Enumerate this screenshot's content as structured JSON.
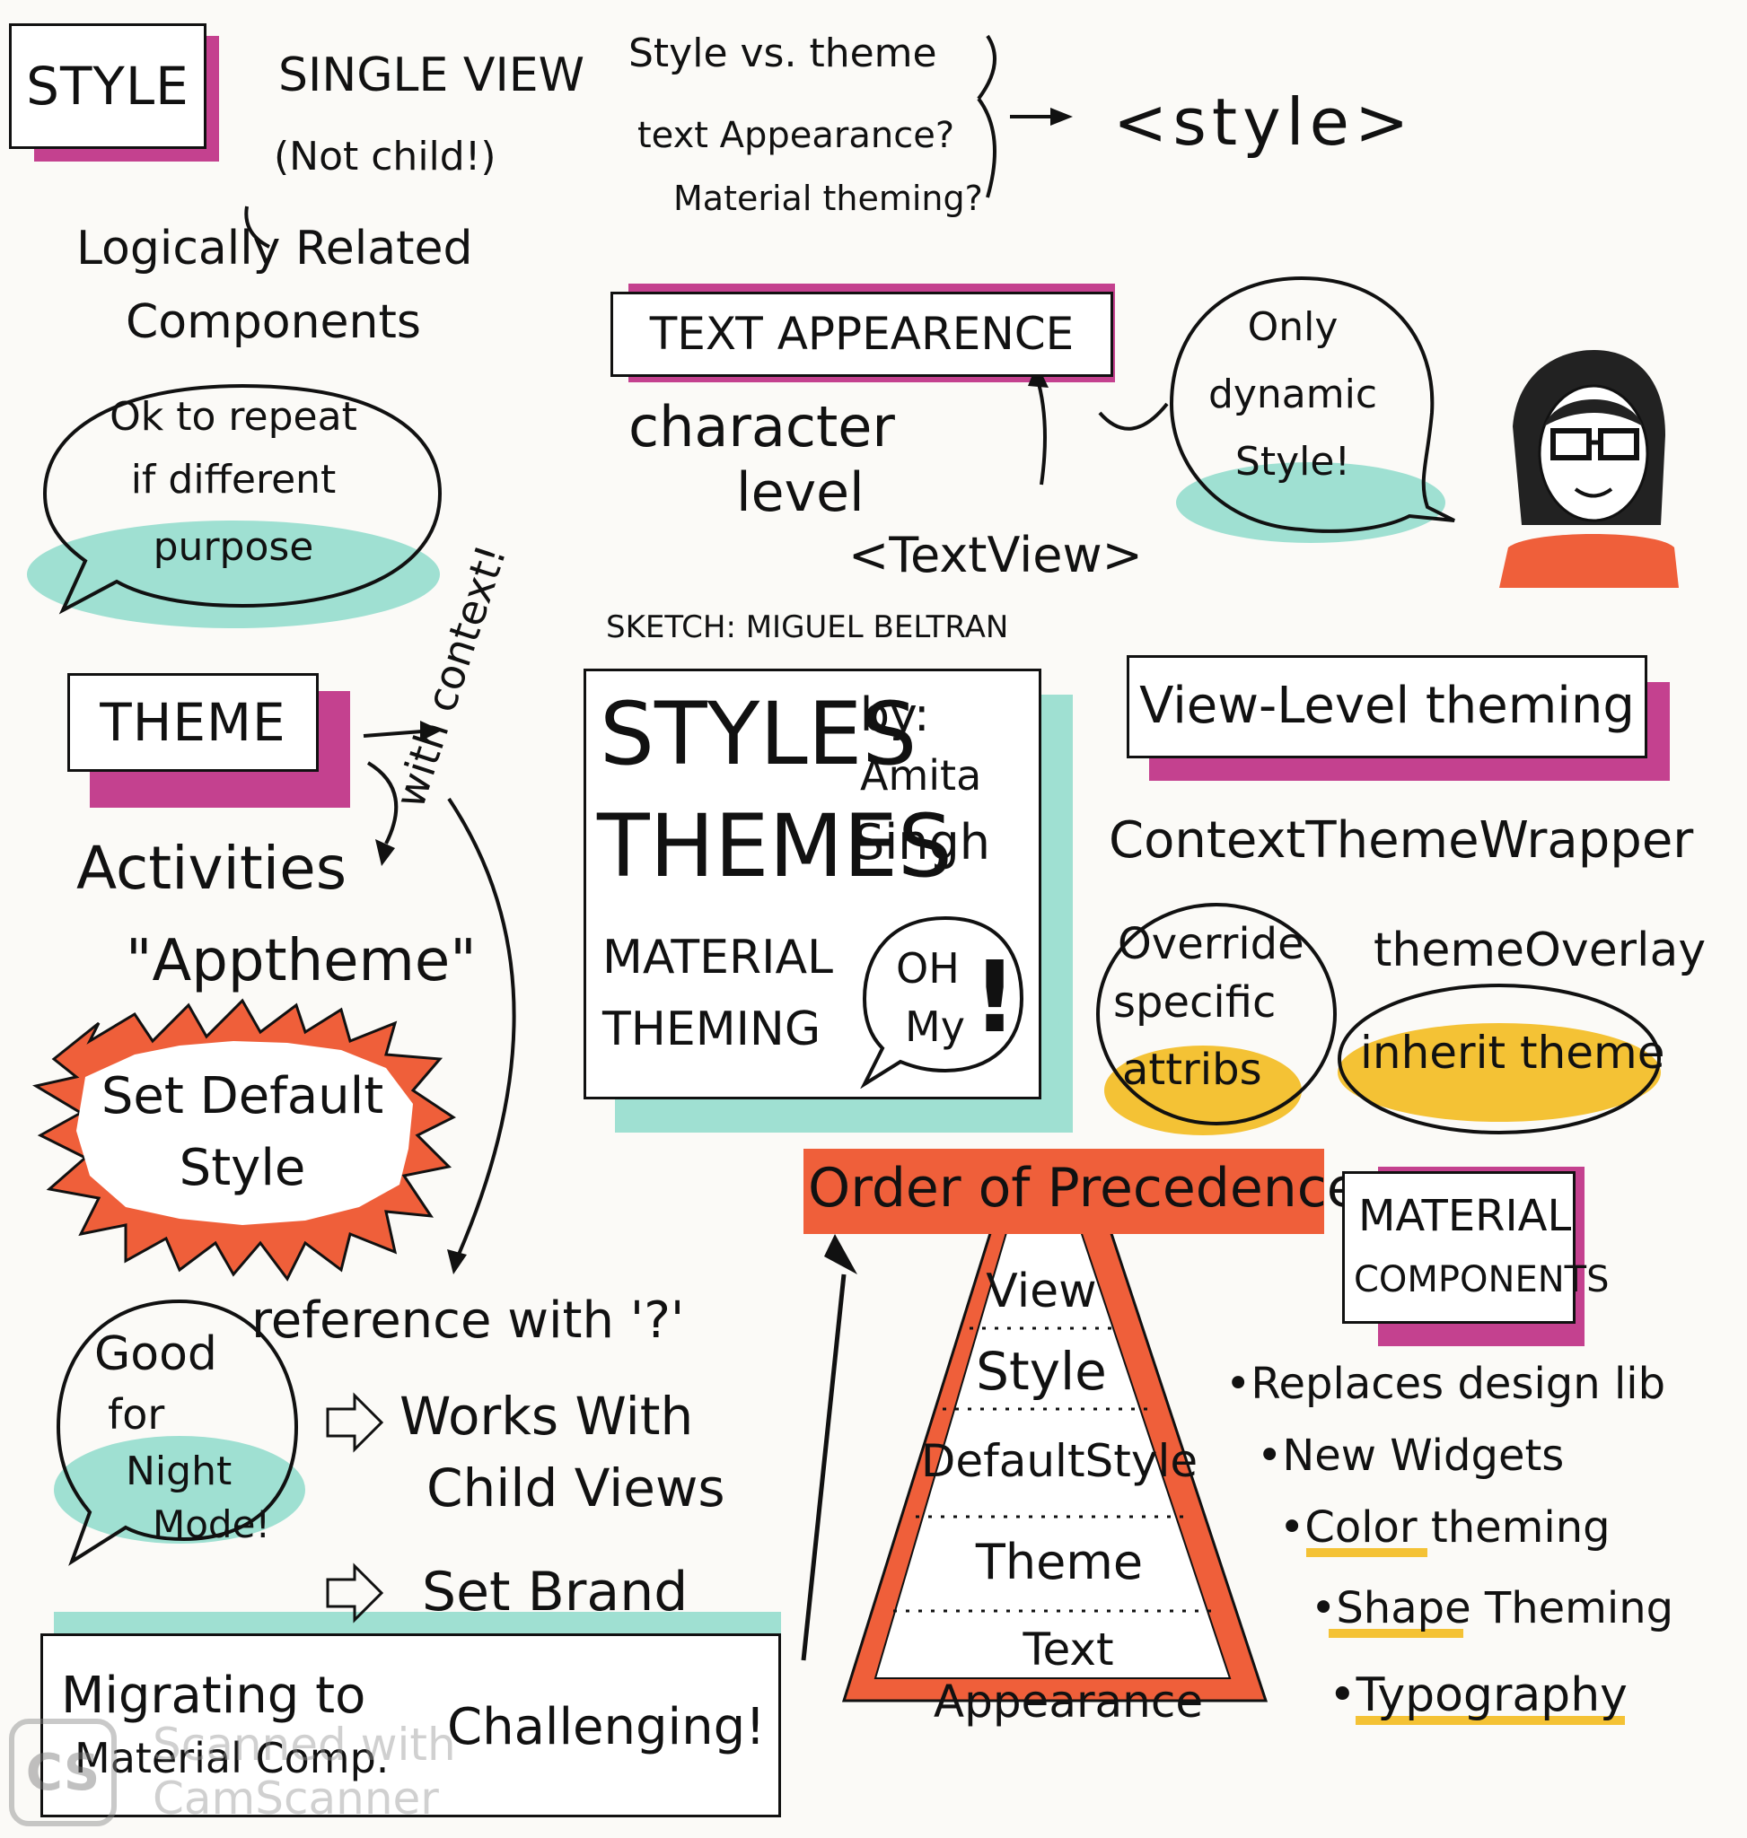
{
  "style_section": {
    "title": "STYLE",
    "single_view": "SINGLE VIEW",
    "not_child": "(Not child!)",
    "logically_related_1": "Logically Related",
    "logically_related_2": "Components",
    "bubble_lines": [
      "Ok to repeat",
      "if different",
      "purpose"
    ]
  },
  "style_vs_theme": {
    "lines": [
      "Style vs. theme",
      "text Appearance?",
      "Material theming?"
    ],
    "arrow_target": "<style>"
  },
  "text_appearance": {
    "title": "TEXT APPEARENCE",
    "character": "character",
    "level": "level",
    "textview": "<TextView>",
    "bubble_lines": [
      "Only",
      "dynamic",
      "Style!"
    ]
  },
  "credit": "SKETCH: MIGUEL BELTRAN",
  "center_card": {
    "styles": "STYLES",
    "themes": "THEMES",
    "material": "MATERIAL",
    "theming": "THEMING",
    "by": "by:",
    "author_1": "Amita",
    "author_2": "Singh",
    "oh": "OH",
    "my": "My",
    "exclaim": "!"
  },
  "theme_section": {
    "title": "THEME",
    "with_context": "with context!",
    "activities": "Activities",
    "apptheme": "\"Apptheme\"",
    "burst_lines": [
      "Set Default",
      "Style"
    ],
    "reference": "reference with '?'",
    "works_with": "Works With",
    "child_views": "Child Views",
    "set_brand": "Set Brand",
    "night_lines": [
      "Good",
      "for",
      "Night",
      "Mode!"
    ]
  },
  "view_level": {
    "title": "View-Level theming",
    "wrapper": "ContextThemeWrapper",
    "override_lines": [
      "Override",
      "specific",
      "attribs"
    ],
    "overlay": "themeOverlay",
    "inherit": "inherit theme"
  },
  "precedence": {
    "title": "Order of Precedence",
    "levels": [
      "View",
      "Style",
      "DefaultStyle",
      "Theme",
      "Text Appearance"
    ]
  },
  "material_components": {
    "title_1": "MATERIAL",
    "title_2": "COMPONENTS",
    "bullets": [
      "Replaces design lib",
      "New Widgets",
      "Color theming",
      "Shape Theming",
      "Typography"
    ]
  },
  "migrating": {
    "line_1": "Migrating to",
    "line_2": "Material Comp.",
    "result": "Challenging!"
  },
  "watermark": {
    "logo": "CS",
    "line_1": "Scanned with",
    "line_2": "CamScanner"
  },
  "colors": {
    "ink": "#111111",
    "magenta": "#c4418f",
    "teal": "#9fe0d2",
    "orange": "#ef5f3a",
    "yellow": "#f4c235",
    "paper": "#fbfaf7"
  }
}
